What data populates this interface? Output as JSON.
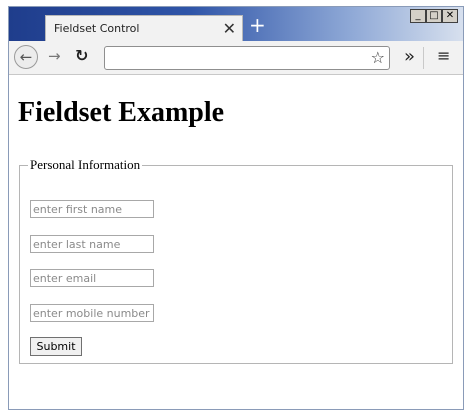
{
  "browser": {
    "tab_title": "Fieldset Control",
    "tab_close": "✕",
    "new_tab": "+",
    "url": "",
    "nav": {
      "back": "←",
      "forward": "→",
      "reload": "↻",
      "star": "☆",
      "overflow": "»",
      "menu": "≡"
    },
    "window_controls": {
      "minimize": "_",
      "maximize": "□",
      "close": "✕"
    }
  },
  "page": {
    "heading": "Fieldset Example",
    "fieldset_legend": "Personal Information",
    "fields": [
      {
        "placeholder": "enter first name"
      },
      {
        "placeholder": "enter last name"
      },
      {
        "placeholder": "enter email"
      },
      {
        "placeholder": "enter mobile number"
      }
    ],
    "submit_label": "Submit"
  }
}
